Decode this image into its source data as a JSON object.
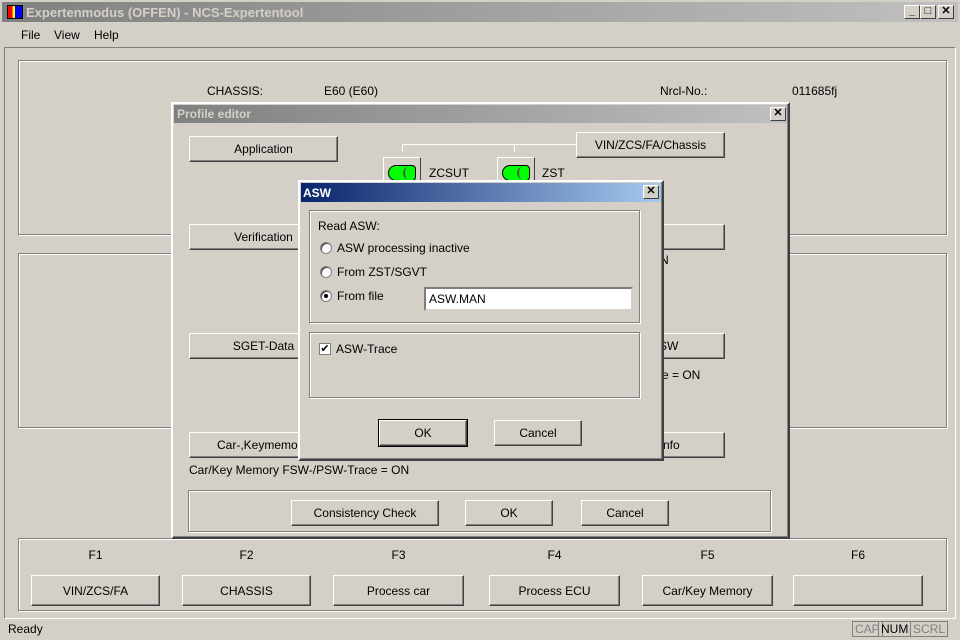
{
  "window": {
    "title": "Expertenmodus (OFFEN) - NCS-Expertentool",
    "min": "_",
    "max": "□",
    "close": "✕"
  },
  "menu": [
    "File",
    "View",
    "Help"
  ],
  "info": {
    "chassis_label": "CHASSIS:",
    "chassis_value": "E60 (E60)",
    "nrcl_label": "Nrcl-No.:",
    "nrcl_value": "011685fj"
  },
  "profile_editor": {
    "title": "Profile editor",
    "close": "✕",
    "left_buttons": [
      "Application",
      "Verification",
      "SGET-Data",
      "Car-,Keymemo"
    ],
    "right_buttons": [
      "VIN/ZCS/FA/Chassis",
      "",
      "SW",
      "nfo"
    ],
    "indicators": [
      "ZCSUT",
      "ZST"
    ],
    "partial_texts": [
      "N",
      "e = ON"
    ],
    "carkey_status": "Car/Key Memory FSW-/PSW-Trace = ON",
    "footer_buttons": [
      "Consistency Check",
      "OK",
      "Cancel"
    ]
  },
  "asw_dialog": {
    "title": "ASW",
    "close": "✕",
    "group_label": "Read ASW:",
    "options": [
      {
        "label": "ASW processing inactive",
        "selected": false
      },
      {
        "label": "From ZST/SGVT",
        "selected": false
      },
      {
        "label": "From file",
        "selected": true
      }
    ],
    "file_value": "ASW.MAN",
    "trace_label": "ASW-Trace",
    "trace_checked": true,
    "ok": "OK",
    "cancel": "Cancel"
  },
  "fkeys": [
    {
      "key": "F1",
      "label": "VIN/ZCS/FA"
    },
    {
      "key": "F2",
      "label": "CHASSIS"
    },
    {
      "key": "F3",
      "label": "Process car"
    },
    {
      "key": "F4",
      "label": "Process ECU"
    },
    {
      "key": "F5",
      "label": "Car/Key Memory"
    },
    {
      "key": "F6",
      "label": ""
    }
  ],
  "status": {
    "text": "Ready",
    "indicators": [
      "CAP",
      "NUM",
      "SCRL"
    ]
  }
}
